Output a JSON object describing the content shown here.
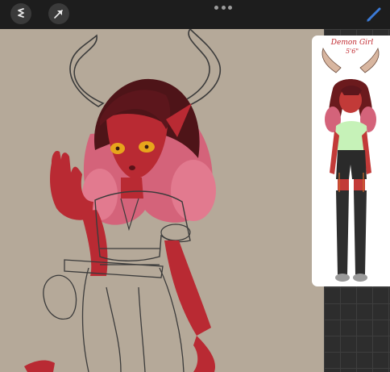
{
  "toolbar": {
    "tools": [
      {
        "name": "adjustments-icon"
      },
      {
        "name": "selection-icon"
      }
    ],
    "menu_icon": "more-dots-icon",
    "brush_icon": "brush-icon",
    "brush_color": "#3b7ad6"
  },
  "canvas": {
    "background": "#b5a999",
    "subject": "character-sketch"
  },
  "reference": {
    "title": "Demon Girl",
    "subtitle": "5'6\""
  },
  "colors": {
    "skin_red": "#b92a33",
    "hair_dark": "#4e1418",
    "hair_pink": "#e27a8f",
    "horn_outline": "#3b3b3b",
    "blouse_green": "#c6f2b8",
    "stockings": "#2e2e2e"
  }
}
